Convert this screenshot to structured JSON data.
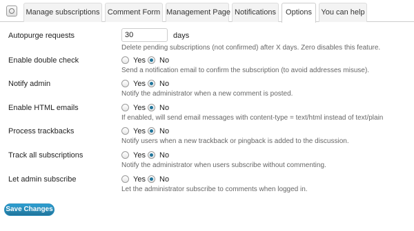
{
  "tabs": [
    {
      "label": "Manage subscriptions",
      "active": false
    },
    {
      "label": "Comment Form",
      "active": false
    },
    {
      "label": "Management Page",
      "active": false
    },
    {
      "label": "Notifications",
      "active": false
    },
    {
      "label": "Options",
      "active": true
    },
    {
      "label": "You can help",
      "active": false
    }
  ],
  "options": {
    "autopurge": {
      "label": "Autopurge requests",
      "value": "30",
      "unit": "days",
      "description": "Delete pending subscriptions (not confirmed) after X days. Zero disables this feature."
    },
    "radio_labels": {
      "yes": "Yes",
      "no": "No"
    },
    "double_check": {
      "label": "Enable double check",
      "selected": "No",
      "description": "Send a notification email to confirm the subscription (to avoid addresses misuse)."
    },
    "notify_admin": {
      "label": "Notify admin",
      "selected": "No",
      "description": "Notify the administrator when a new comment is posted."
    },
    "html_emails": {
      "label": "Enable HTML emails",
      "selected": "No",
      "description": "If enabled, will send email messages with content-type = text/html instead of text/plain"
    },
    "trackbacks": {
      "label": "Process trackbacks",
      "selected": "No",
      "description": "Notify users when a new trackback or pingback is added to the discussion."
    },
    "track_all": {
      "label": "Track all subscriptions",
      "selected": "No",
      "description": "Notify the administrator when users subscribe without commenting."
    },
    "admin_subscribe": {
      "label": "Let admin subscribe",
      "selected": "No",
      "description": "Let the administrator subscribe to comments when logged in."
    }
  },
  "save_label": "Save Changes",
  "colors": {
    "accent": "#21759b",
    "button_top": "#2e9fd2"
  }
}
